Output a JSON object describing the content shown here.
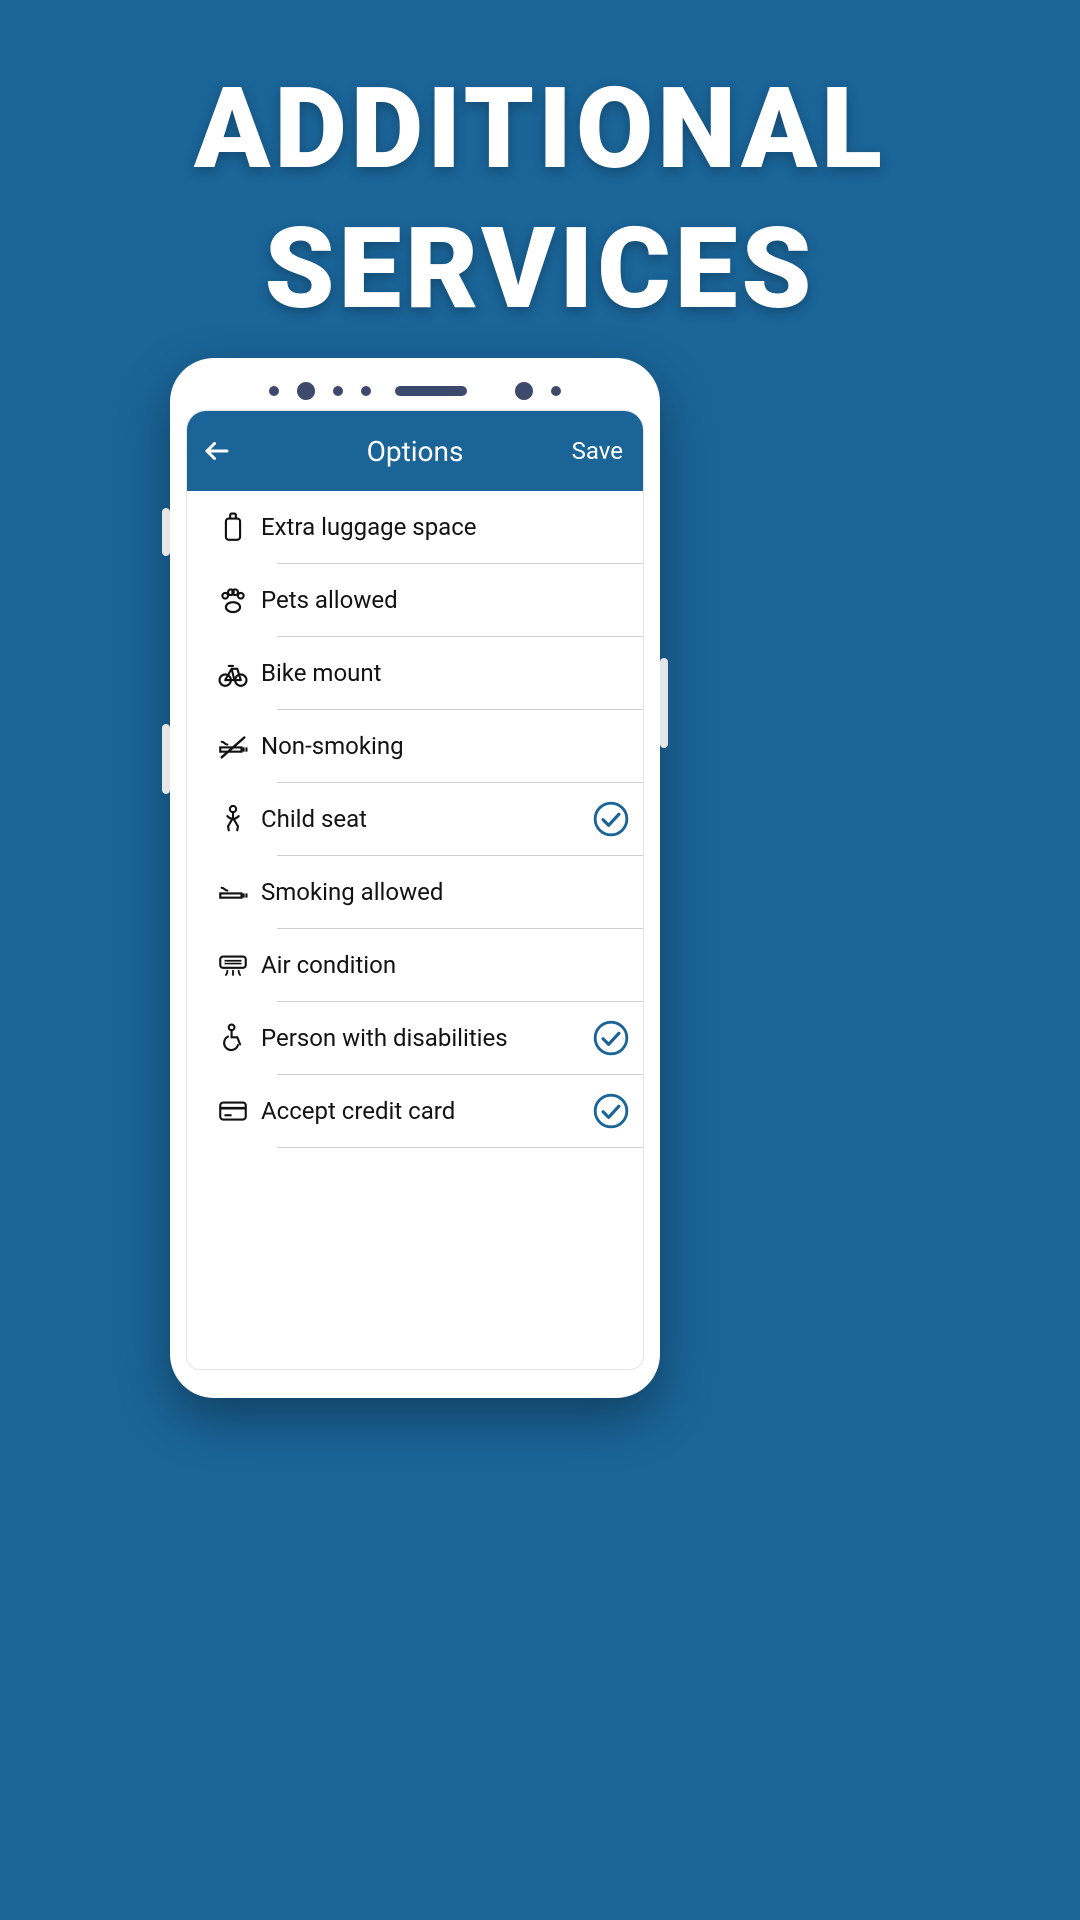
{
  "hero": {
    "line1": "ADDITIONAL",
    "line2": "SERVICES"
  },
  "colors": {
    "background": "#1a6498",
    "accent": "#1a6498",
    "text": "#131313"
  },
  "app_bar": {
    "title": "Options",
    "save_label": "Save"
  },
  "options": [
    {
      "id": "extra-luggage",
      "icon": "luggage-icon",
      "label": "Extra luggage space",
      "checked": false
    },
    {
      "id": "pets-allowed",
      "icon": "paw-icon",
      "label": "Pets allowed",
      "checked": false
    },
    {
      "id": "bike-mount",
      "icon": "bicycle-icon",
      "label": "Bike mount",
      "checked": false
    },
    {
      "id": "non-smoking",
      "icon": "no-smoking-icon",
      "label": "Non-smoking",
      "checked": false
    },
    {
      "id": "child-seat",
      "icon": "baby-icon",
      "label": "Child seat",
      "checked": true
    },
    {
      "id": "smoking-allowed",
      "icon": "cigarette-icon",
      "label": "Smoking allowed",
      "checked": false
    },
    {
      "id": "air-condition",
      "icon": "ac-icon",
      "label": "Air condition",
      "checked": false
    },
    {
      "id": "disabilities",
      "icon": "wheelchair-icon",
      "label": "Person with disabilities",
      "checked": true
    },
    {
      "id": "credit-card",
      "icon": "credit-card-icon",
      "label": "Accept credit card",
      "checked": true
    }
  ]
}
